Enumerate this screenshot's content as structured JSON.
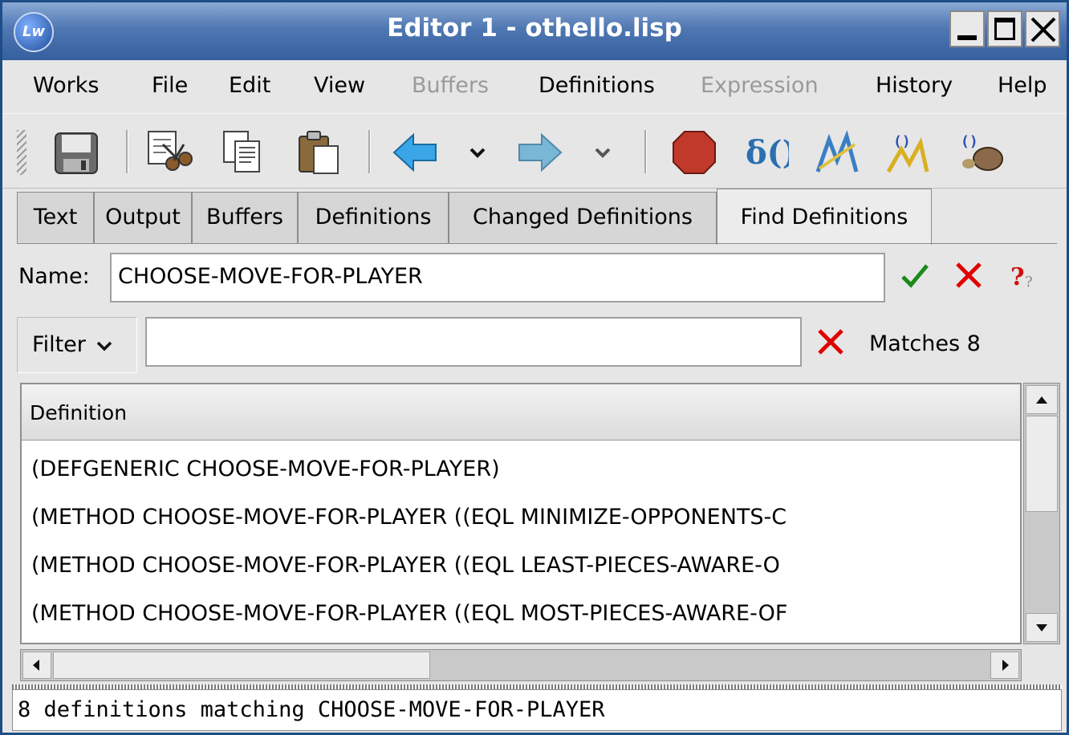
{
  "window": {
    "title": "Editor 1 - othello.lisp",
    "logo_text": "Lw"
  },
  "menu": [
    {
      "label": "Works",
      "enabled": true
    },
    {
      "label": "File",
      "enabled": true
    },
    {
      "label": "Edit",
      "enabled": true
    },
    {
      "label": "View",
      "enabled": true
    },
    {
      "label": "Buffers",
      "enabled": false
    },
    {
      "label": "Definitions",
      "enabled": true
    },
    {
      "label": "Expression",
      "enabled": false
    },
    {
      "label": "History",
      "enabled": true
    },
    {
      "label": "Help",
      "enabled": true
    }
  ],
  "toolbar": {
    "icons": [
      "save-icon",
      "cut-icon",
      "copy-icon",
      "paste-icon",
      "back-icon",
      "back-history-icon",
      "forward-icon",
      "forward-history-icon",
      "stop-icon",
      "inspect-icon",
      "profile-icon",
      "trace-icon",
      "debug-icon"
    ]
  },
  "tabs": [
    {
      "label": "Text"
    },
    {
      "label": "Output"
    },
    {
      "label": "Buffers"
    },
    {
      "label": "Definitions"
    },
    {
      "label": "Changed Definitions"
    },
    {
      "label": "Find Definitions",
      "active": true
    }
  ],
  "name_row": {
    "label": "Name:",
    "value": "CHOOSE-MOVE-FOR-PLAYER"
  },
  "filter_row": {
    "filter_label": "Filter",
    "value": "",
    "matches_text": "Matches 8"
  },
  "list": {
    "header": "Definition",
    "rows": [
      "(DEFGENERIC CHOOSE-MOVE-FOR-PLAYER)",
      "(METHOD CHOOSE-MOVE-FOR-PLAYER ((EQL MINIMIZE-OPPONENTS-C",
      "(METHOD CHOOSE-MOVE-FOR-PLAYER ((EQL LEAST-PIECES-AWARE-O",
      "(METHOD CHOOSE-MOVE-FOR-PLAYER ((EQL MOST-PIECES-AWARE-OF"
    ]
  },
  "status": {
    "text": "8 definitions matching CHOOSE-MOVE-FOR-PLAYER"
  },
  "colors": {
    "titlebar": "#4f77b2",
    "ok_check": "#1a8a1a",
    "cancel_x": "#e00000"
  }
}
